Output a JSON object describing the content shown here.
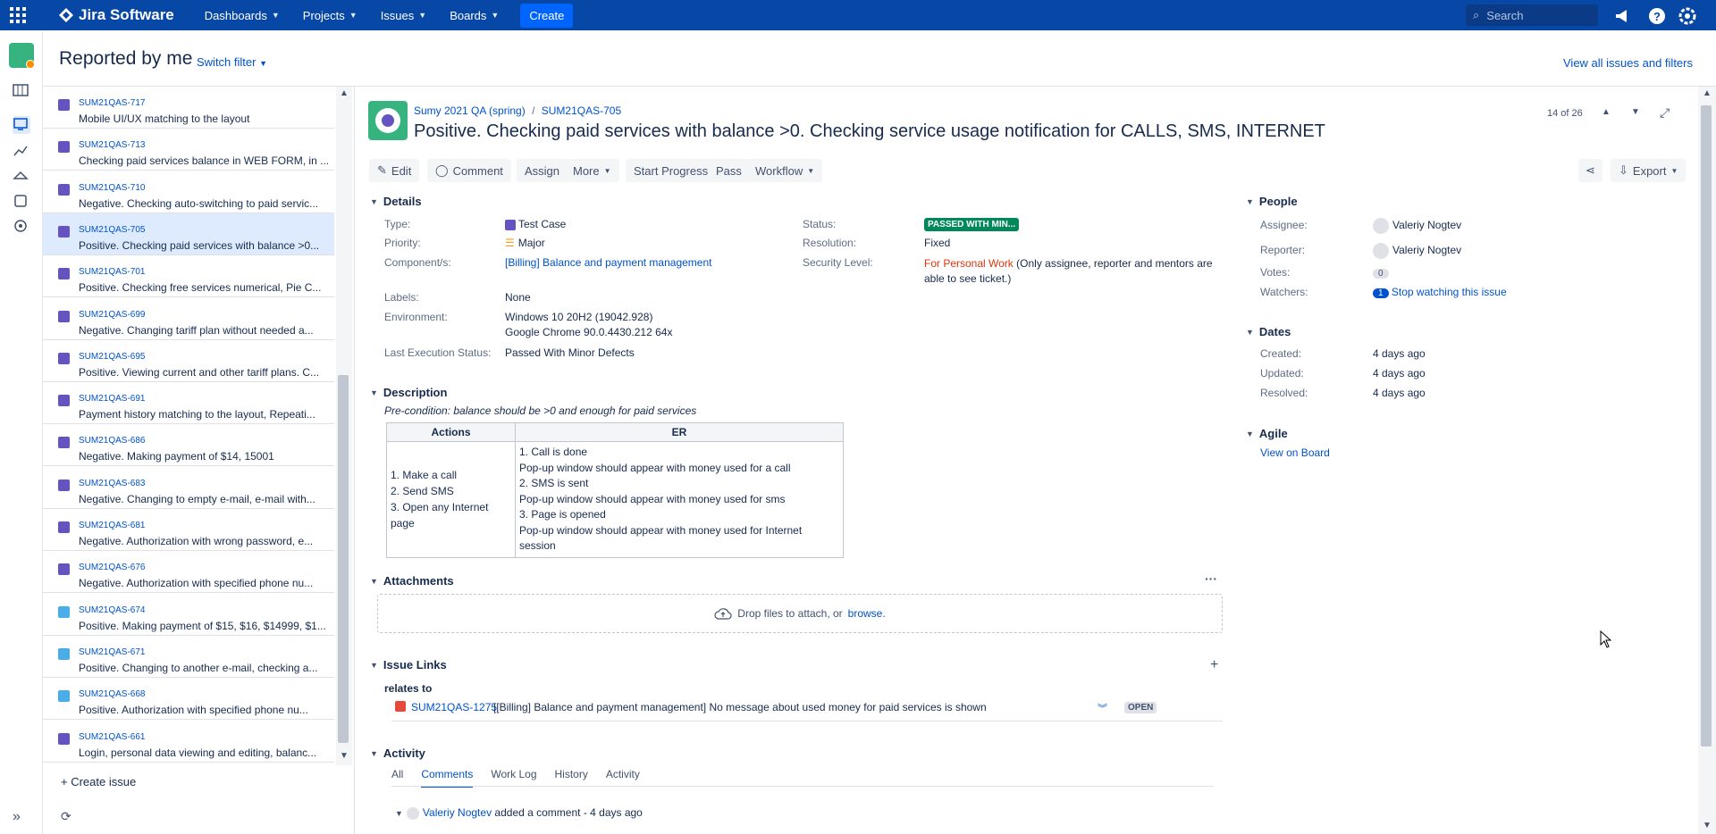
{
  "topbar": {
    "app_name": "Jira Software",
    "menus": [
      "Dashboards",
      "Projects",
      "Issues",
      "Boards"
    ],
    "create_label": "Create",
    "search_placeholder": "Search"
  },
  "page": {
    "title": "Reported by me",
    "switch_filter": "Switch filter",
    "view_all": "View all issues and filters"
  },
  "issues": [
    {
      "key": "SUM21QAS-717",
      "summary": "Mobile UI/UX matching to the layout",
      "type": "test"
    },
    {
      "key": "SUM21QAS-713",
      "summary": "Checking paid services balance in WEB FORM, in ...",
      "type": "test"
    },
    {
      "key": "SUM21QAS-710",
      "summary": "Negative. Checking auto-switching to paid servic...",
      "type": "test"
    },
    {
      "key": "SUM21QAS-705",
      "summary": "Positive. Checking paid services with balance >0...",
      "type": "test",
      "selected": true
    },
    {
      "key": "SUM21QAS-701",
      "summary": "Positive. Checking free services numerical, Pie C...",
      "type": "test"
    },
    {
      "key": "SUM21QAS-699",
      "summary": "Negative. Changing tariff plan without needed a...",
      "type": "test"
    },
    {
      "key": "SUM21QAS-695",
      "summary": "Positive. Viewing current and other tariff plans. C...",
      "type": "test"
    },
    {
      "key": "SUM21QAS-691",
      "summary": "Payment history matching to the layout, Repeati...",
      "type": "test"
    },
    {
      "key": "SUM21QAS-686",
      "summary": "Negative. Making payment of $14, 15001",
      "type": "test"
    },
    {
      "key": "SUM21QAS-683",
      "summary": "Negative. Changing to empty e-mail, e-mail with...",
      "type": "test"
    },
    {
      "key": "SUM21QAS-681",
      "summary": "Negative. Authorization with wrong password, e...",
      "type": "test"
    },
    {
      "key": "SUM21QAS-676",
      "summary": "Negative. Authorization with specified phone nu...",
      "type": "test"
    },
    {
      "key": "SUM21QAS-674",
      "summary": "Positive. Making payment of $15, $16, $14999, $1...",
      "type": "sub"
    },
    {
      "key": "SUM21QAS-671",
      "summary": "Positive. Changing to another e-mail, checking a...",
      "type": "sub"
    },
    {
      "key": "SUM21QAS-668",
      "summary": "Positive. Authorization with specified phone nu...",
      "type": "sub"
    },
    {
      "key": "SUM21QAS-661",
      "summary": "Login, personal data viewing and editing, balanc...",
      "type": "check"
    }
  ],
  "create_issue": "Create issue",
  "issue": {
    "project": "Sumy 2021 QA (spring)",
    "key": "SUM21QAS-705",
    "title": "Positive. Checking paid services with balance >0. Checking service usage notification for CALLS, SMS, INTERNET",
    "pager": "14 of 26",
    "toolbar": {
      "edit": "Edit",
      "comment": "Comment",
      "assign": "Assign",
      "more": "More",
      "start": "Start Progress",
      "pass": "Pass",
      "workflow": "Workflow",
      "export": "Export"
    },
    "details": {
      "heading": "Details",
      "type_label": "Type:",
      "type": "Test Case",
      "priority_label": "Priority:",
      "priority": "Major",
      "component_label": "Component/s:",
      "component": "[Billing] Balance and payment management",
      "labels_label": "Labels:",
      "labels": "None",
      "env_label": "Environment:",
      "env1": "Windows 10 20H2 (19042.928)",
      "env2": "Google Chrome 90.0.4430.212 64x",
      "last_exec_label": "Last Execution Status:",
      "last_exec": "Passed With Minor Defects",
      "status_label": "Status:",
      "status": "PASSED WITH MIN...",
      "resolution_label": "Resolution:",
      "resolution": "Fixed",
      "security_label": "Security Level:",
      "security": "For Personal Work",
      "security_note1": "(Only assignee, reporter and mentors are",
      "security_note2": "able to see ticket.)"
    },
    "description": {
      "heading": "Description",
      "precondition": "Pre-condition: balance should be >0 and enough for paid services",
      "col_actions": "Actions",
      "col_er": "ER",
      "actions": [
        "1. Make a call",
        "2. Send SMS",
        "3. Open any Internet page"
      ],
      "er": [
        "1. Call is done",
        "Pop-up window should appear with money used for a call",
        "2. SMS is sent",
        "Pop-up window should appear with money used for sms",
        "3. Page is opened",
        "Pop-up window should appear with money used for Internet session"
      ]
    },
    "attachments": {
      "heading": "Attachments",
      "drop": "Drop files to attach, or",
      "browse": "browse."
    },
    "links": {
      "heading": "Issue Links",
      "relates": "relates to",
      "link_key": "SUM21QAS-1275",
      "link_text": "[[Billing] Balance and payment management] No message about used money for paid services is shown",
      "link_status": "OPEN"
    },
    "activity": {
      "heading": "Activity",
      "tabs": [
        "All",
        "Comments",
        "Work Log",
        "History",
        "Activity"
      ],
      "author": "Valeriy Nogtev",
      "action": "added a comment - 4 days ago"
    },
    "people": {
      "heading": "People",
      "assignee_label": "Assignee:",
      "assignee": "Valeriy Nogtev",
      "reporter_label": "Reporter:",
      "reporter": "Valeriy Nogtev",
      "votes_label": "Votes:",
      "votes": "0",
      "watchers_label": "Watchers:",
      "watchers": "1",
      "watch_link": "Stop watching this issue"
    },
    "dates": {
      "heading": "Dates",
      "created_label": "Created:",
      "created": "4 days ago",
      "updated_label": "Updated:",
      "updated": "4 days ago",
      "resolved_label": "Resolved:",
      "resolved": "4 days ago"
    },
    "agile": {
      "heading": "Agile",
      "link": "View on Board"
    }
  },
  "colors": {
    "topbar": "#0747a6",
    "accent": "#0052cc",
    "success": "#00875a",
    "test_icon": "#6554c0",
    "sub_icon": "#4bade8"
  }
}
